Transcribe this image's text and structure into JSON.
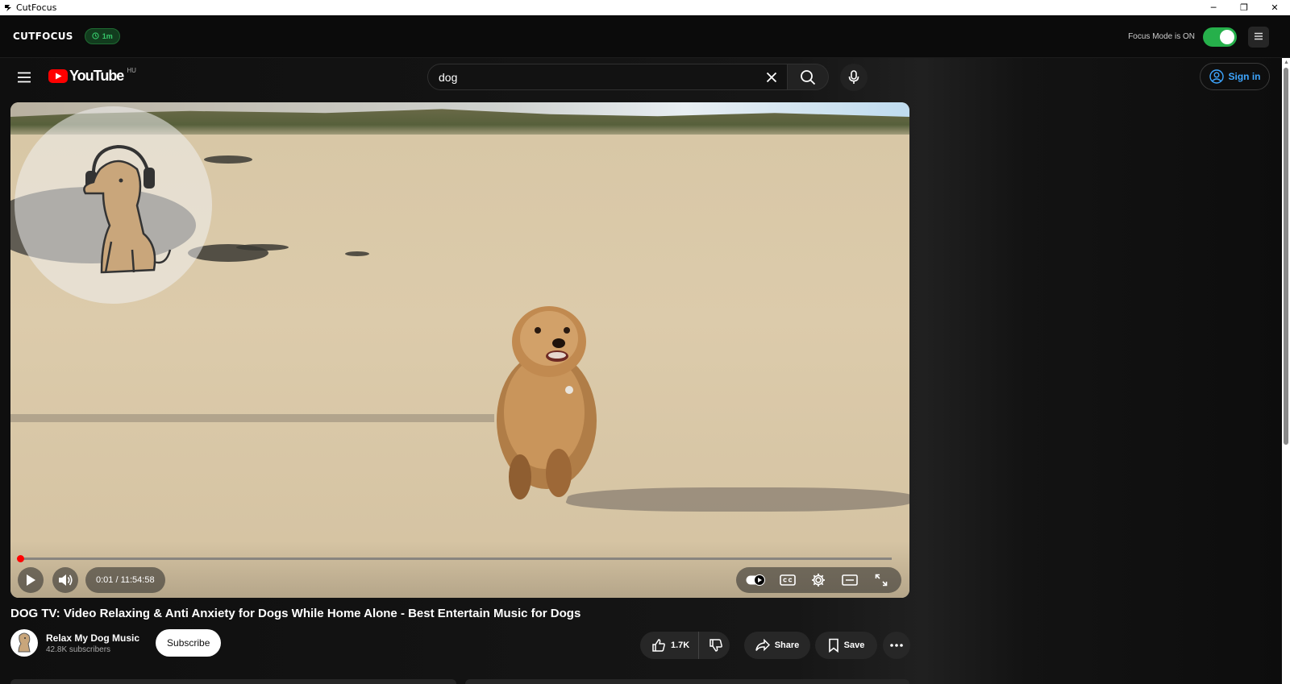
{
  "window": {
    "title": "CutFocus",
    "minimize_glyph": "─",
    "restore_glyph": "❐",
    "close_glyph": "✕"
  },
  "cutfocus": {
    "logo": "CUTFOCUS",
    "timer": "1m",
    "focus_label": "Focus Mode is ON",
    "focus_on": true
  },
  "youtube": {
    "logo_text": "YouTube",
    "region": "HU",
    "search_value": "dog",
    "sign_in": "Sign in"
  },
  "player": {
    "time": "0:01 / 11:54:58",
    "progress": 0.0014
  },
  "video": {
    "title": "DOG TV: Video Relaxing & Anti Anxiety for Dogs While Home Alone - Best Entertain Music for Dogs",
    "channel": "Relax My Dog Music",
    "subscribers": "42.8K subscribers",
    "subscribe": "Subscribe",
    "likes": "1.7K",
    "share": "Share",
    "save": "Save"
  },
  "colors": {
    "accent_red": "#ff0000",
    "link_blue": "#3ea6ff",
    "focus_green": "#26b04b"
  }
}
